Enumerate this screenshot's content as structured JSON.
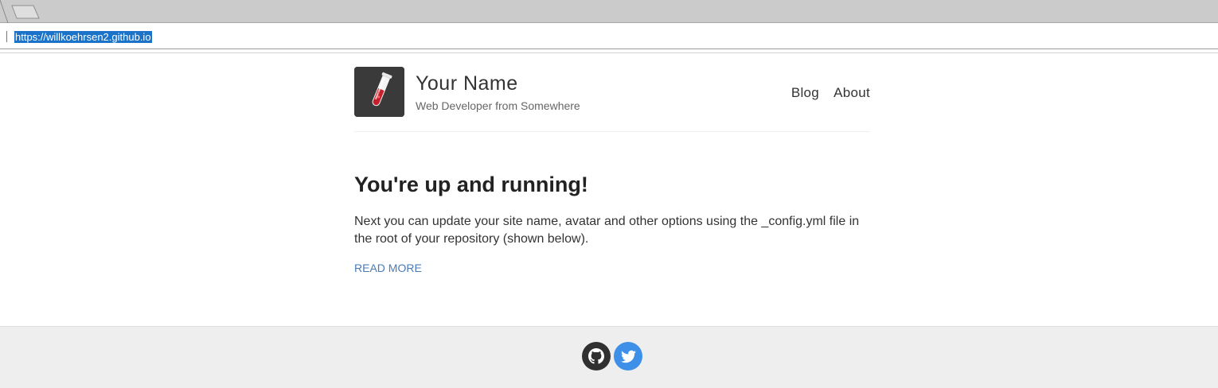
{
  "browser": {
    "url": "https://willkoehrsen2.github.io"
  },
  "site": {
    "name": "Your Name",
    "description": "Web Developer from Somewhere",
    "nav": [
      {
        "label": "Blog"
      },
      {
        "label": "About"
      }
    ]
  },
  "post": {
    "title": "You're up and running!",
    "excerpt": "Next you can update your site name, avatar and other options using the _config.yml file in the root of your repository (shown below).",
    "read_more": "READ MORE"
  },
  "footer": {
    "social": [
      {
        "icon": "github-icon",
        "color": "#303030"
      },
      {
        "icon": "twitter-icon",
        "color": "#3d8fe8"
      }
    ]
  },
  "colors": {
    "link": "#4a7bb5",
    "url_highlight": "#1a73c8",
    "footer_bg": "#eeeeee"
  }
}
